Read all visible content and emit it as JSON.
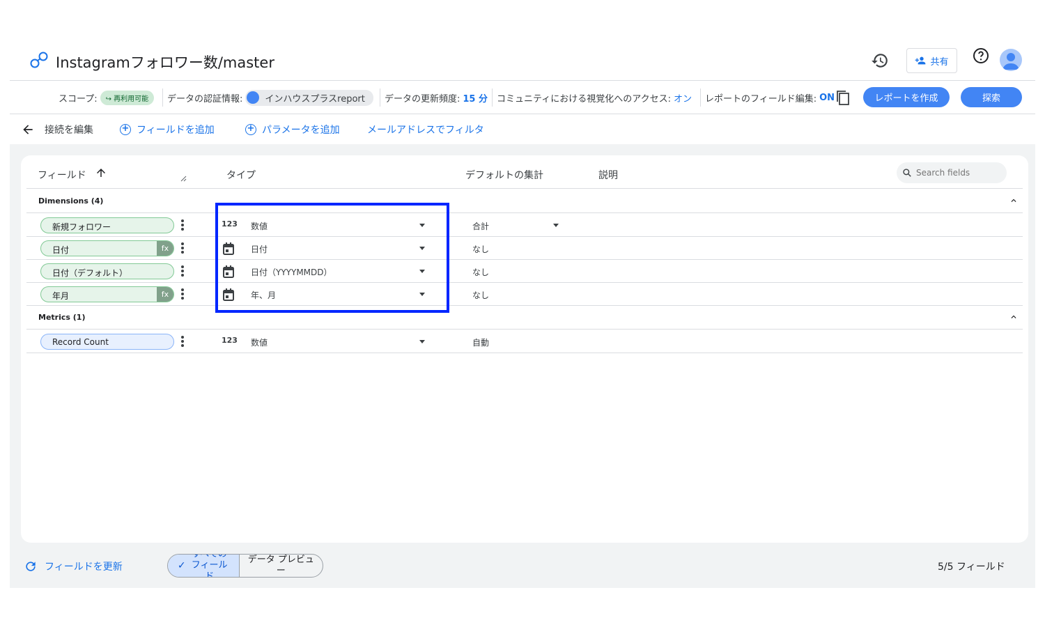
{
  "header": {
    "title": "Instagramフォロワー数/master",
    "share_label": "共有"
  },
  "infobar": {
    "scope_label": "スコープ:",
    "scope_value": "再利用可能",
    "credentials_label": "データの認証情報:",
    "credentials_value": "インハウスプラスreport",
    "freshness_label": "データの更新頻度:",
    "freshness_value": "15 分",
    "community_label": "コミュニティにおける視覚化へのアクセス:",
    "community_value": "オン",
    "field_edit_label": "レポートのフィールド編集:",
    "field_edit_value": "ON",
    "create_report_label": "レポートを作成",
    "explore_label": "探索"
  },
  "toolbar": {
    "back_label": "接続を編集",
    "add_field_label": "フィールドを追加",
    "add_param_label": "パラメータを追加",
    "email_filter_label": "メールアドレスでフィルタ"
  },
  "table": {
    "headers": {
      "field": "フィールド",
      "type": "タイプ",
      "aggregation": "デフォルトの集計",
      "description": "説明"
    },
    "search_placeholder": "Search fields",
    "dimensions_label": "Dimensions (4)",
    "metrics_label": "Metrics (1)",
    "dimensions": [
      {
        "name": "新規フォロワー",
        "fx": "",
        "type_icon": "123",
        "type": "数値",
        "agg": "合計"
      },
      {
        "name": "日付",
        "fx": "fx",
        "type_icon": "calendar-icon",
        "type": "日付",
        "agg": "なし"
      },
      {
        "name": "日付（デフォルト）",
        "fx": "",
        "type_icon": "calendar-icon",
        "type": "日付（YYYYMMDD）",
        "agg": "なし"
      },
      {
        "name": "年月",
        "fx": "fx",
        "type_icon": "calendar-icon",
        "type": "年、月",
        "agg": "なし"
      }
    ],
    "metrics": [
      {
        "name": "Record Count",
        "type_icon": "123",
        "type": "数値",
        "agg": "自動"
      }
    ]
  },
  "footer": {
    "refresh_label": "フィールドを更新",
    "all_fields_label": "すべてのフィールド",
    "preview_label": "データ プレビュー",
    "count_label": "5/5 フィールド"
  },
  "colors": {
    "accent": "#1a73e8",
    "highlight_box": "#0026ff",
    "dimension_chip": "#e6f4ea",
    "metric_chip": "#e8f0fe"
  }
}
